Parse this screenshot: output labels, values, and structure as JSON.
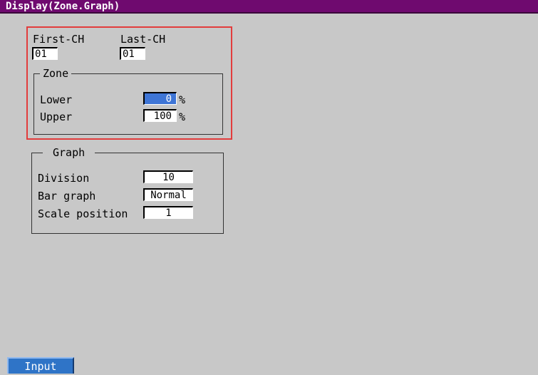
{
  "title": "Display(Zone.Graph)",
  "channel": {
    "first_label": "First-CH",
    "first_value": "01",
    "last_label": "Last-CH",
    "last_value": "01"
  },
  "zone": {
    "title": "Zone",
    "lower_label": "Lower",
    "lower_value": "0",
    "lower_unit": "%",
    "upper_label": "Upper",
    "upper_value": "100",
    "upper_unit": "%"
  },
  "graph": {
    "title": "Graph",
    "division_label": "Division",
    "division_value": "10",
    "bar_graph_label": "Bar graph",
    "bar_graph_value": "Normal",
    "scale_position_label": "Scale position",
    "scale_position_value": "1"
  },
  "softkey": {
    "input_label": "Input"
  },
  "colors": {
    "titlebar": "#6f0a6f",
    "background": "#c8c8c8",
    "selected_field": "#3e75d6",
    "highlight_box": "#e23c3c",
    "softkey": "#2f74c7"
  }
}
